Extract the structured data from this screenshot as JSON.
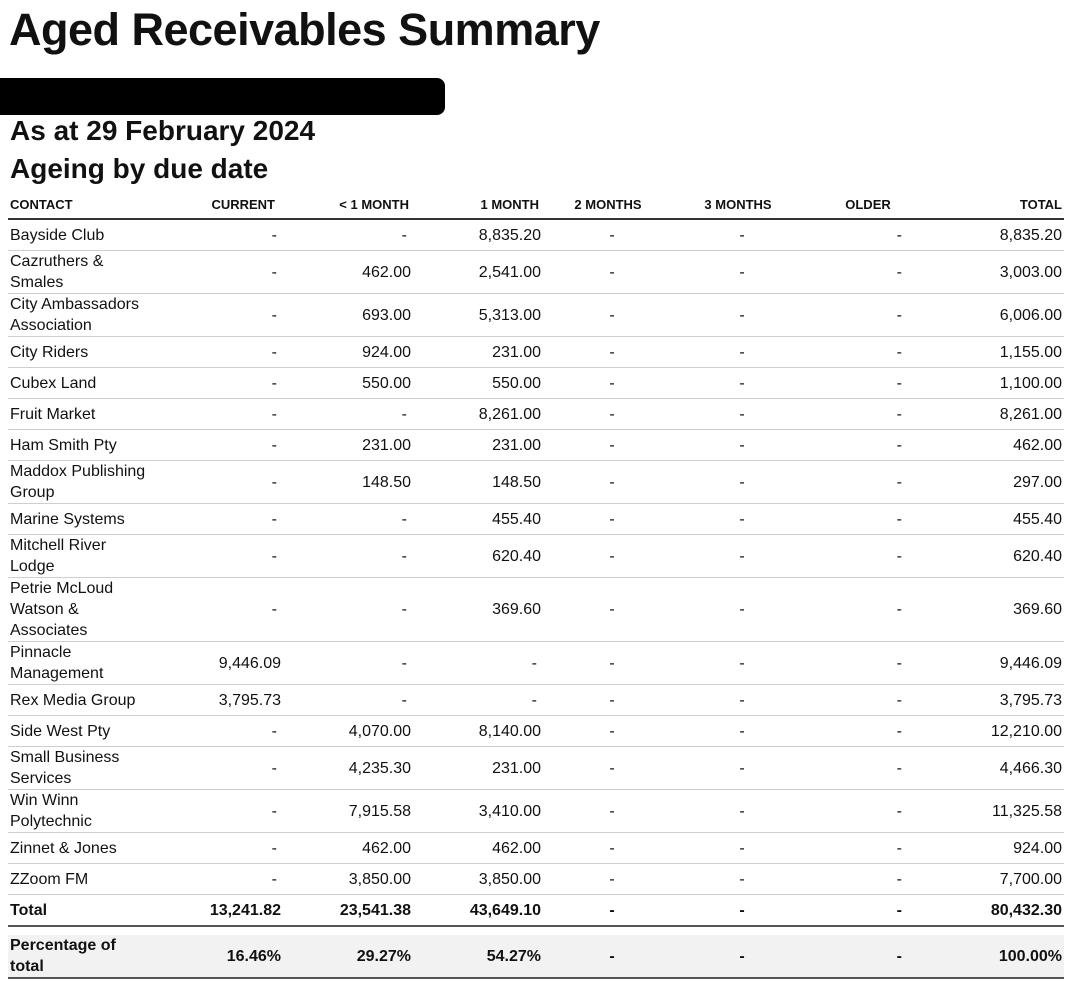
{
  "report": {
    "title": "Aged Receivables Summary",
    "as_at": "As at 29 February 2024",
    "ageing": "Ageing by due date"
  },
  "columns": [
    "CONTACT",
    "CURRENT",
    "< 1 MONTH",
    "1 MONTH",
    "2 MONTHS",
    "3 MONTHS",
    "OLDER",
    "TOTAL"
  ],
  "rows": [
    {
      "contact": "Bayside Club",
      "current": "-",
      "lt1": "-",
      "m1": "8,835.20",
      "m2": "-",
      "m3": "-",
      "older": "-",
      "total": "8,835.20"
    },
    {
      "contact": "Cazruthers & Smales",
      "current": "-",
      "lt1": "462.00",
      "m1": "2,541.00",
      "m2": "-",
      "m3": "-",
      "older": "-",
      "total": "3,003.00"
    },
    {
      "contact": "City Ambassadors Association",
      "current": "-",
      "lt1": "693.00",
      "m1": "5,313.00",
      "m2": "-",
      "m3": "-",
      "older": "-",
      "total": "6,006.00"
    },
    {
      "contact": "City Riders",
      "current": "-",
      "lt1": "924.00",
      "m1": "231.00",
      "m2": "-",
      "m3": "-",
      "older": "-",
      "total": "1,155.00"
    },
    {
      "contact": "Cubex Land",
      "current": "-",
      "lt1": "550.00",
      "m1": "550.00",
      "m2": "-",
      "m3": "-",
      "older": "-",
      "total": "1,100.00"
    },
    {
      "contact": "Fruit Market",
      "current": "-",
      "lt1": "-",
      "m1": "8,261.00",
      "m2": "-",
      "m3": "-",
      "older": "-",
      "total": "8,261.00"
    },
    {
      "contact": "Ham Smith Pty",
      "current": "-",
      "lt1": "231.00",
      "m1": "231.00",
      "m2": "-",
      "m3": "-",
      "older": "-",
      "total": "462.00"
    },
    {
      "contact": "Maddox Publishing Group",
      "current": "-",
      "lt1": "148.50",
      "m1": "148.50",
      "m2": "-",
      "m3": "-",
      "older": "-",
      "total": "297.00"
    },
    {
      "contact": "Marine Systems",
      "current": "-",
      "lt1": "-",
      "m1": "455.40",
      "m2": "-",
      "m3": "-",
      "older": "-",
      "total": "455.40"
    },
    {
      "contact": "Mitchell River Lodge",
      "current": "-",
      "lt1": "-",
      "m1": "620.40",
      "m2": "-",
      "m3": "-",
      "older": "-",
      "total": "620.40"
    },
    {
      "contact": "Petrie McLoud Watson & Associates",
      "current": "-",
      "lt1": "-",
      "m1": "369.60",
      "m2": "-",
      "m3": "-",
      "older": "-",
      "total": "369.60"
    },
    {
      "contact": "Pinnacle Management",
      "current": "9,446.09",
      "lt1": "-",
      "m1": "-",
      "m2": "-",
      "m3": "-",
      "older": "-",
      "total": "9,446.09"
    },
    {
      "contact": "Rex Media Group",
      "current": "3,795.73",
      "lt1": "-",
      "m1": "-",
      "m2": "-",
      "m3": "-",
      "older": "-",
      "total": "3,795.73"
    },
    {
      "contact": "Side West Pty",
      "current": "-",
      "lt1": "4,070.00",
      "m1": "8,140.00",
      "m2": "-",
      "m3": "-",
      "older": "-",
      "total": "12,210.00"
    },
    {
      "contact": "Small Business Services",
      "current": "-",
      "lt1": "4,235.30",
      "m1": "231.00",
      "m2": "-",
      "m3": "-",
      "older": "-",
      "total": "4,466.30"
    },
    {
      "contact": "Win Winn Polytechnic",
      "current": "-",
      "lt1": "7,915.58",
      "m1": "3,410.00",
      "m2": "-",
      "m3": "-",
      "older": "-",
      "total": "11,325.58"
    },
    {
      "contact": "Zinnet & Jones",
      "current": "-",
      "lt1": "462.00",
      "m1": "462.00",
      "m2": "-",
      "m3": "-",
      "older": "-",
      "total": "924.00"
    },
    {
      "contact": "ZZoom FM",
      "current": "-",
      "lt1": "3,850.00",
      "m1": "3,850.00",
      "m2": "-",
      "m3": "-",
      "older": "-",
      "total": "7,700.00"
    }
  ],
  "totals": {
    "label": "Total",
    "current": "13,241.82",
    "lt1": "23,541.38",
    "m1": "43,649.10",
    "m2": "-",
    "m3": "-",
    "older": "-",
    "total": "80,432.30"
  },
  "percentages": {
    "label": "Percentage of total",
    "current": "16.46%",
    "lt1": "29.27%",
    "m1": "54.27%",
    "m2": "-",
    "m3": "-",
    "older": "-",
    "total": "100.00%"
  }
}
